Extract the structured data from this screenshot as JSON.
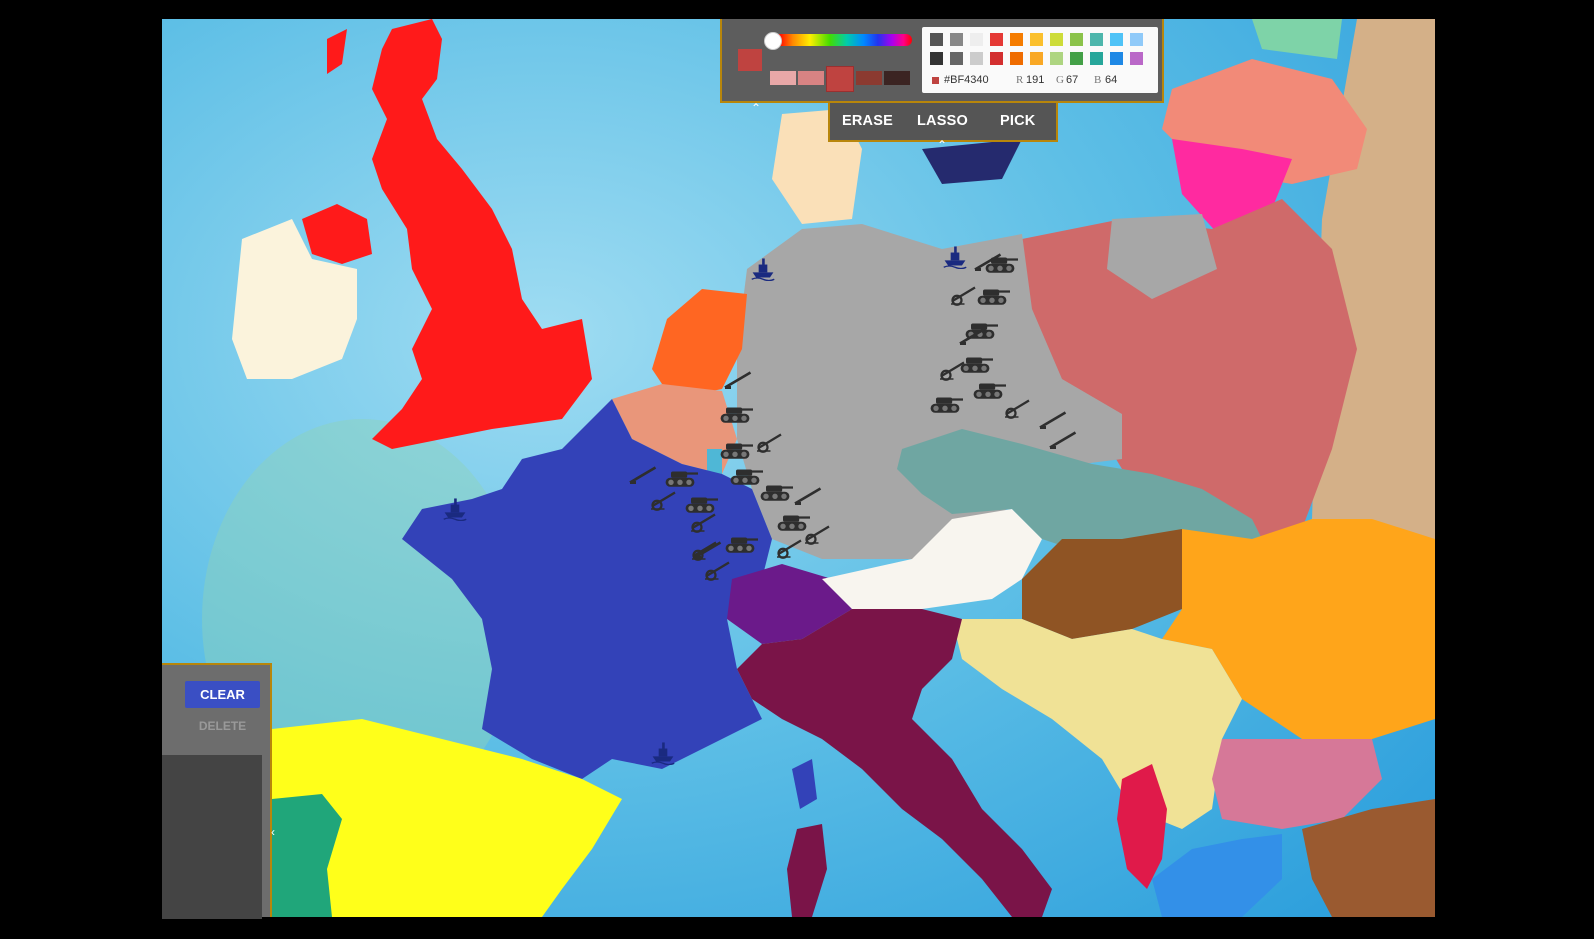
{
  "palette": {
    "hex_value": "#BF4340",
    "r_label": "R",
    "r_value": "191",
    "g_label": "G",
    "g_value": "67",
    "b_label": "B",
    "b_value": "64",
    "current_color": "#bf4340",
    "shades": [
      "#e8a8a8",
      "#d88383",
      "#bf4340",
      "#8b3a30",
      "#3b2422"
    ],
    "grid_colors_row1": [
      "#555555",
      "#888888",
      "#eeeeee",
      "#e53935",
      "#f57c00",
      "#fbc02d",
      "#cddc39",
      "#8bc34a",
      "#4db6ac",
      "#4fc3f7",
      "#90caf9"
    ],
    "grid_colors_row2": [
      "#333333",
      "#666666",
      "#cccccc",
      "#d32f2f",
      "#ef6c00",
      "#f9a825",
      "#aed581",
      "#43a047",
      "#26a69a",
      "#1e88e5",
      "#ba68c8"
    ],
    "toggle_glyph": "⌃"
  },
  "tools": {
    "erase_label": "ERASE",
    "lasso_label": "LASSO",
    "pick_label": "PICK",
    "toggle_glyph": "⌃"
  },
  "side_panel": {
    "clear_label": "CLEAR",
    "delete_label": "DELETE",
    "toggle_glyph": "‹"
  },
  "map": {
    "sea_color": "#6cc6e8",
    "regions": [
      {
        "name": "United Kingdom",
        "color": "#ff1a1a"
      },
      {
        "name": "Ireland",
        "color": "#fbf3dc"
      },
      {
        "name": "France",
        "color": "#3342b8"
      },
      {
        "name": "Spain",
        "color": "#ffff1a"
      },
      {
        "name": "Portugal",
        "color": "#20a67a"
      },
      {
        "name": "Germany",
        "color": "#a7a7a7"
      },
      {
        "name": "Netherlands",
        "color": "#ff6622"
      },
      {
        "name": "Belgium",
        "color": "#e9967a"
      },
      {
        "name": "Switzerland",
        "color": "#6b1a8a"
      },
      {
        "name": "Italy",
        "color": "#7a1448"
      },
      {
        "name": "Austria",
        "color": "#f8f5ef"
      },
      {
        "name": "Czechoslovakia",
        "color": "#6fa6a2"
      },
      {
        "name": "Poland",
        "color": "#cf6a6a"
      },
      {
        "name": "Hungary",
        "color": "#8f5424"
      },
      {
        "name": "Romania",
        "color": "#ffa51a"
      },
      {
        "name": "Yugoslavia",
        "color": "#f0e296"
      },
      {
        "name": "Bulgaria",
        "color": "#d67898"
      },
      {
        "name": "Albania",
        "color": "#e01a4a"
      },
      {
        "name": "Greece",
        "color": "#3390e8"
      },
      {
        "name": "Lithuania",
        "color": "#ff2aa0"
      },
      {
        "name": "Latvia",
        "color": "#f28a78"
      },
      {
        "name": "Soviet Union",
        "color": "#d4b088"
      },
      {
        "name": "Denmark",
        "color": "#fae0b8"
      },
      {
        "name": "Sweden",
        "color": "#252a6e"
      },
      {
        "name": "Turkey",
        "color": "#9a5a30"
      }
    ],
    "units": [
      {
        "type": "tank-icon",
        "count": 14
      },
      {
        "type": "artillery-icon",
        "count": 10
      },
      {
        "type": "infantry-icon",
        "count": 8
      },
      {
        "type": "ship-icon",
        "count": 4
      }
    ]
  }
}
